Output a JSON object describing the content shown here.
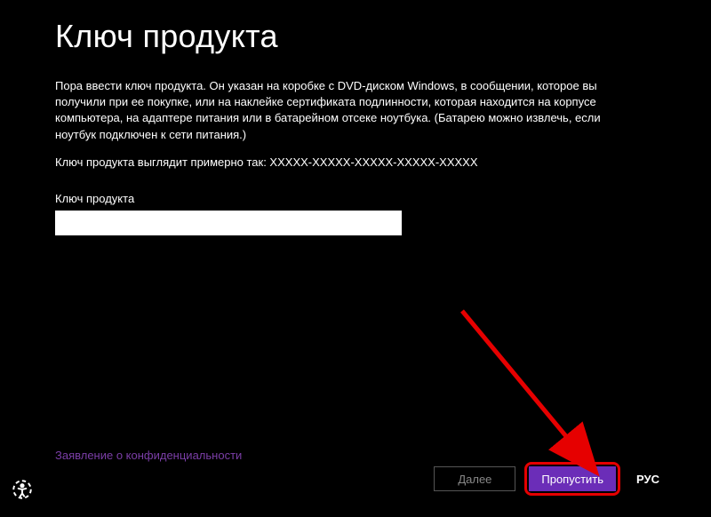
{
  "title": "Ключ продукта",
  "description": "Пора ввести ключ продукта. Он указан на коробке с DVD-диском Windows, в сообщении, которое вы получили при ее покупке, или на наклейке сертификата подлинности, которая находится на корпусе компьютера, на адаптере питания или в батарейном отсеке ноутбука. (Батарею можно извлечь, если ноутбук подключен к сети питания.)",
  "example": "Ключ продукта выглядит примерно так: XXXXX-XXXXX-XXXXX-XXXXX-XXXXX",
  "field_label": "Ключ продукта",
  "product_key_value": "",
  "privacy_link": "Заявление о конфиденциальности",
  "buttons": {
    "next": "Далее",
    "skip": "Пропустить"
  },
  "language_indicator": "РУС"
}
